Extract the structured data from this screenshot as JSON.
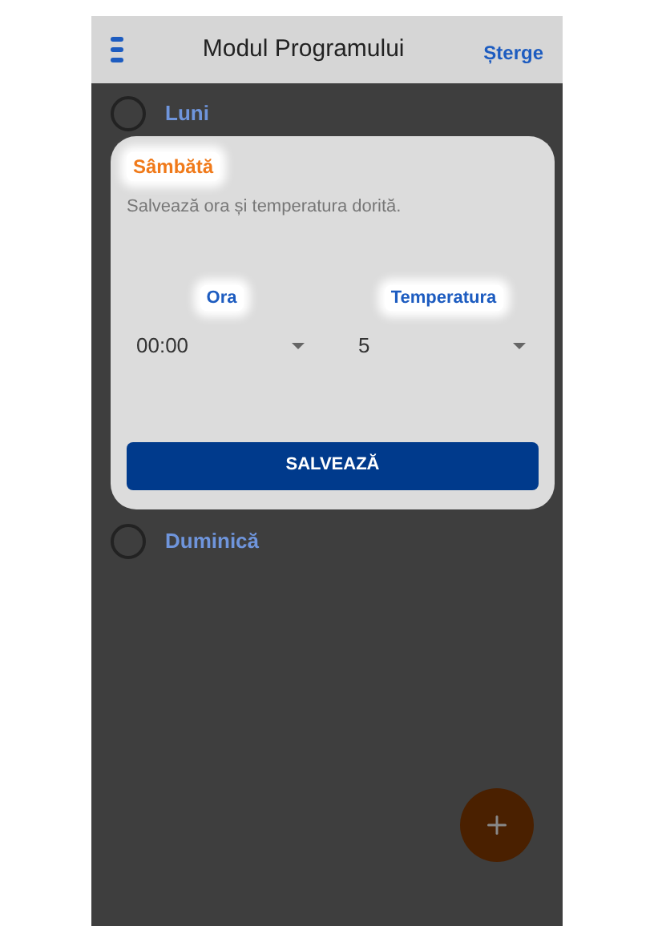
{
  "header": {
    "title": "Modul Programului",
    "action": "Șterge"
  },
  "days": [
    {
      "label": "Luni",
      "selected": false
    },
    {
      "label": "Duminică",
      "selected": false
    }
  ],
  "dialog": {
    "title": "Sâmbătă",
    "subtitle": "Salvează ora și temperatura dorită.",
    "fields": [
      {
        "label": "Ora",
        "value": "00:00"
      },
      {
        "label": "Temperatura",
        "value": "5"
      }
    ],
    "button": "SALVEAZĂ"
  }
}
